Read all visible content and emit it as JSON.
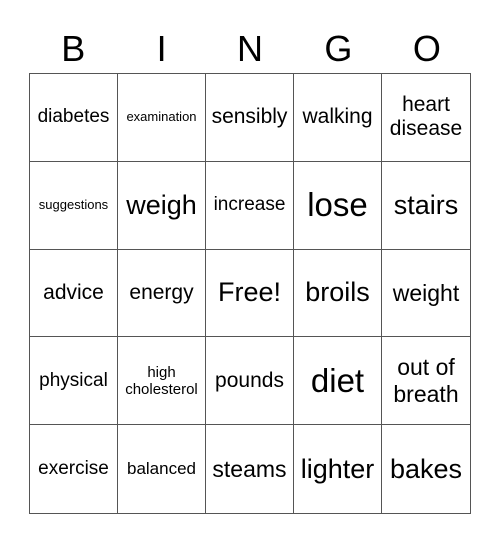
{
  "header": [
    "B",
    "I",
    "N",
    "G",
    "O"
  ],
  "cells": [
    {
      "text": "diabetes",
      "size": "s19"
    },
    {
      "text": "examination",
      "size": "s13"
    },
    {
      "text": "sensibly",
      "size": "s21"
    },
    {
      "text": "walking",
      "size": "s21"
    },
    {
      "text": "heart disease",
      "size": "s21"
    },
    {
      "text": "suggestions",
      "size": "s13"
    },
    {
      "text": "weigh",
      "size": "s27"
    },
    {
      "text": "increase",
      "size": "s19"
    },
    {
      "text": "lose",
      "size": "s33"
    },
    {
      "text": "stairs",
      "size": "s27"
    },
    {
      "text": "advice",
      "size": "s21"
    },
    {
      "text": "energy",
      "size": "s21"
    },
    {
      "text": "Free!",
      "size": "s27"
    },
    {
      "text": "broils",
      "size": "s27"
    },
    {
      "text": "weight",
      "size": "s23"
    },
    {
      "text": "physical",
      "size": "s19"
    },
    {
      "text": "high cholesterol",
      "size": "s15"
    },
    {
      "text": "pounds",
      "size": "s21"
    },
    {
      "text": "diet",
      "size": "s33"
    },
    {
      "text": "out of breath",
      "size": "s23"
    },
    {
      "text": "exercise",
      "size": "s19"
    },
    {
      "text": "balanced",
      "size": "s17"
    },
    {
      "text": "steams",
      "size": "s23"
    },
    {
      "text": "lighter",
      "size": "s27"
    },
    {
      "text": "bakes",
      "size": "s27"
    }
  ]
}
